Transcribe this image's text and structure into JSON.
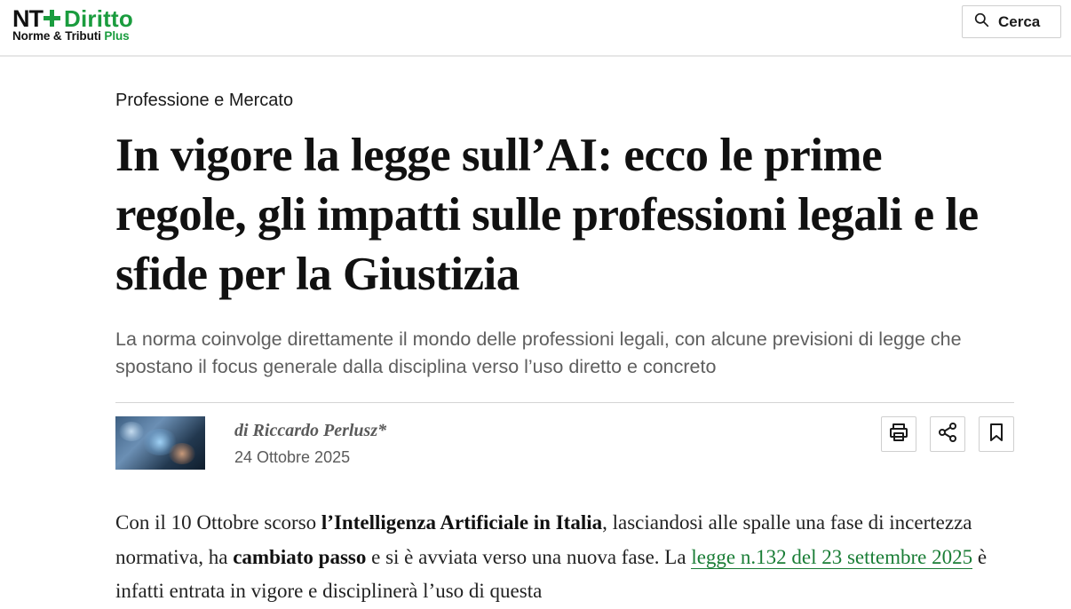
{
  "header": {
    "logo_nt": "NT",
    "logo_brand": "Diritto",
    "logo_sub_main": "Norme & Tributi",
    "logo_sub_plus": "Plus",
    "search_label": "Cerca",
    "icons": {
      "search": "search-icon"
    }
  },
  "article": {
    "section": "Professione e Mercato",
    "title": "In vigore la legge sull’AI: ecco le prime regole, gli impatti sulle professioni legali e le sfide per la Giustizia",
    "subtitle": "La norma coinvolge direttamente il mondo delle professioni legali, con alcune previsioni di legge che spostano il focus generale dalla disciplina verso l’uso diretto e concreto",
    "author": "di Riccardo Perlusz*",
    "date": "24 Ottobre 2025",
    "actions": {
      "print_icon": "print-icon",
      "share_icon": "share-icon",
      "bookmark_icon": "bookmark-icon"
    },
    "body": {
      "p1_a": "Con il 10 Ottobre scorso ",
      "p1_b": "l’Intelligenza Artificiale in Italia",
      "p1_c": ", lasciandosi alle spalle una fase di incertezza normativa, ha ",
      "p1_d": "cambiato passo",
      "p1_e": " e si è avviata verso una nuova fase. La ",
      "p1_link": "legge n.132 del 23 settembre 2025",
      "p1_f": " è infatti entrata in vigore e disciplinerà l’uso di questa"
    }
  },
  "colors": {
    "brand_green": "#1a9c3e",
    "link_green": "#1a7d36",
    "text": "#1a1a1a",
    "muted": "#5e5e5e"
  }
}
